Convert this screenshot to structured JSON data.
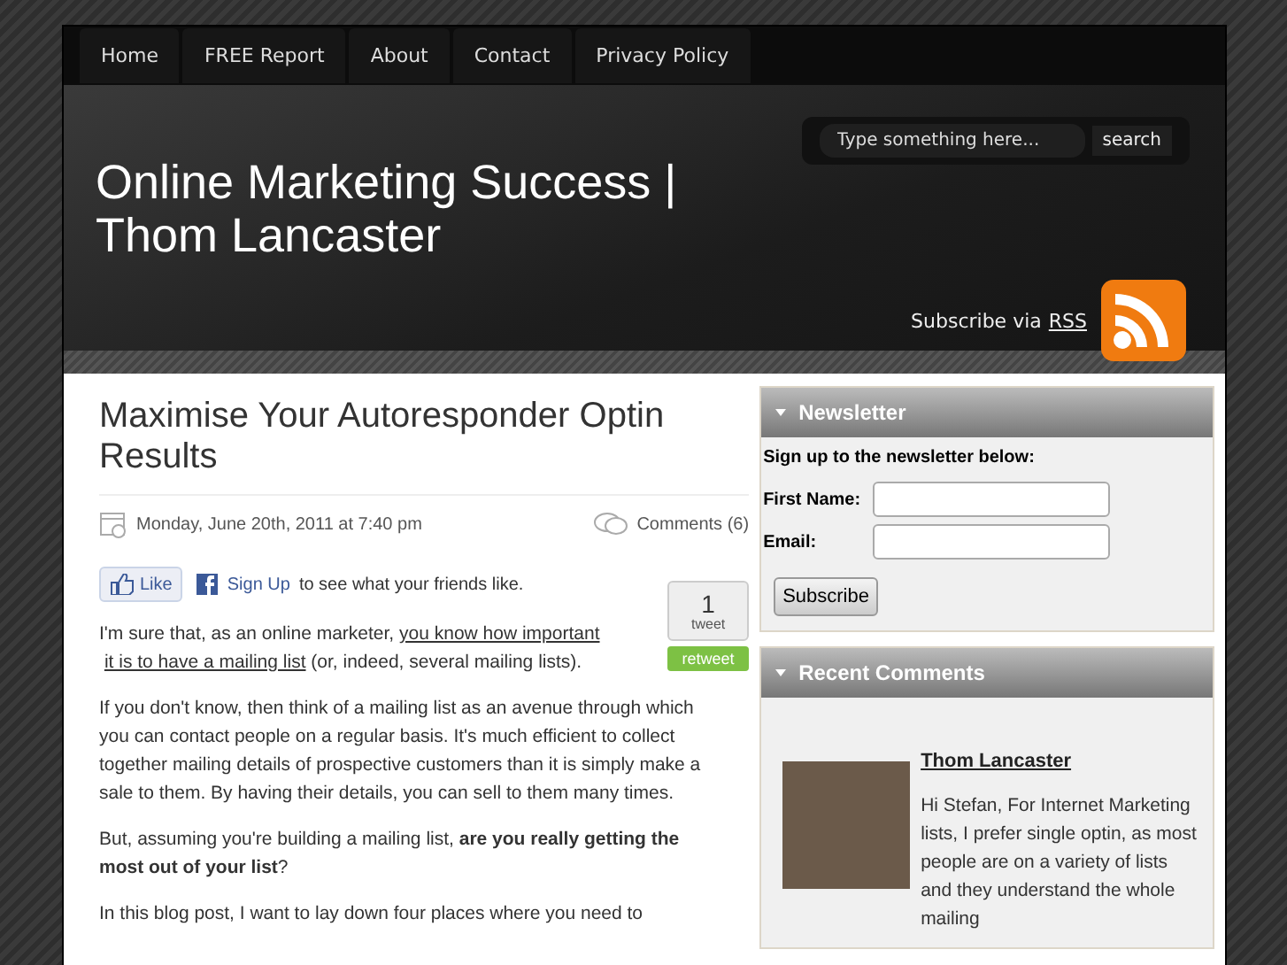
{
  "nav": [
    {
      "label": "Home",
      "selected": false
    },
    {
      "label": "FREE Report",
      "selected": false
    },
    {
      "label": "About",
      "selected": false
    },
    {
      "label": "Contact",
      "selected": false
    },
    {
      "label": "Privacy Policy",
      "selected": false
    }
  ],
  "search": {
    "placeholder": "Type something here...",
    "button": "search"
  },
  "site_title": "Online Marketing Success | Thom Lancaster",
  "subscribe": {
    "text": "Subscribe via",
    "link": "RSS"
  },
  "post": {
    "title": "Maximise Your Autoresponder Optin Results",
    "date": "Monday, June 20th, 2011 at 7:40 pm",
    "comments": "Comments (6)",
    "like": {
      "button": "Like",
      "signup": "Sign Up",
      "text": "to see what your friends like."
    },
    "tweet": {
      "count": "1",
      "label": "tweet",
      "button": "retweet"
    },
    "paragraphs": [
      [
        {
          "kind": "text",
          "text": "I'm sure that, as an online marketer, "
        },
        {
          "kind": "link",
          "text": "you know how important"
        },
        {
          "kind": "link",
          "text": "it is to have a mailing list"
        },
        {
          "kind": "text",
          "text": " (or, indeed, several mailing lists)."
        }
      ],
      [
        {
          "kind": "text",
          "text": "If you don't know, then think of a mailing list as an avenue through which you can contact people on a regular basis. It's much efficient to collect together mailing details of prospective customers than it is simply make a sale to them. By having their details, you can sell to them many times."
        }
      ],
      [
        {
          "kind": "text",
          "text": "But, assuming you're building a mailing list, **are you really getting the most out of your list**?"
        }
      ],
      [
        {
          "kind": "text",
          "text": "In this blog post, I want to lay down four places where you need to"
        }
      ]
    ]
  },
  "newsletter": {
    "title": "Newsletter",
    "intro": "Sign up to the newsletter below:",
    "fields": [
      {
        "label": "First Name:"
      },
      {
        "label": "Email:"
      }
    ],
    "button": "Subscribe"
  },
  "recent_comments": {
    "title": "Recent Comments",
    "items": [
      {
        "author": "Thom Lancaster",
        "text": "Hi Stefan, For Internet Marketing lists, I prefer single optin, as most people are on a variety of lists and they understand the whole mailing"
      }
    ]
  }
}
